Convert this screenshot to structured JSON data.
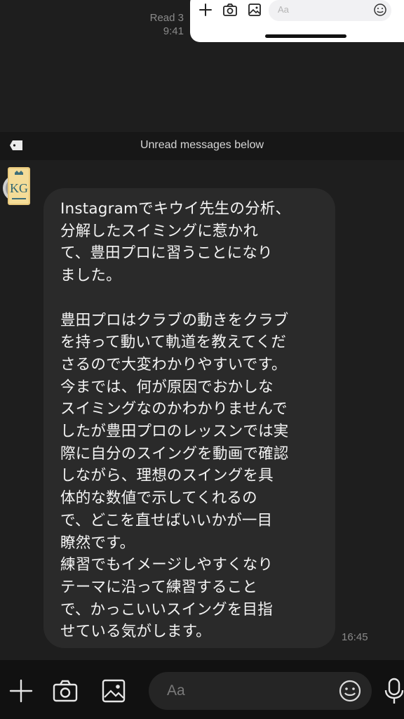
{
  "read_status": {
    "label": "Read 3",
    "time": "9:41"
  },
  "overlay": {
    "input_placeholder": "Aa"
  },
  "unread_banner": {
    "text": "Unread messages below"
  },
  "message": {
    "sender_avatar_text": "KG",
    "body": "Instagramでキウイ先生の分析、\n分解したスイミングに惹かれ\nて、豊田プロに習うことになり\nました。\n\n豊田プロはクラブの動きをクラブ\nを持って動いて軌道を教えてくだ\nさるので大変わかりやすいです。\n今までは、何が原因でおかしな\nスイミングなのかわかりませんで\nしたが豊田プロのレッスンでは実\n際に自分のスイングを動画で確認\nしながら、理想のスイングを具\n体的な数値で示してくれるの\nで、どこを直せばいいかが一目\n瞭然です。\n練習でもイメージしやすくなり\nテーマに沿って練習すること\nで、かっこいいスイングを目指\nせている気がします。",
    "time": "16:45"
  },
  "composer": {
    "placeholder": "Aa"
  },
  "colors": {
    "background": "#1e1e1e",
    "bubble": "#2a2a2a",
    "banner": "#171717",
    "bar": "#111111"
  }
}
